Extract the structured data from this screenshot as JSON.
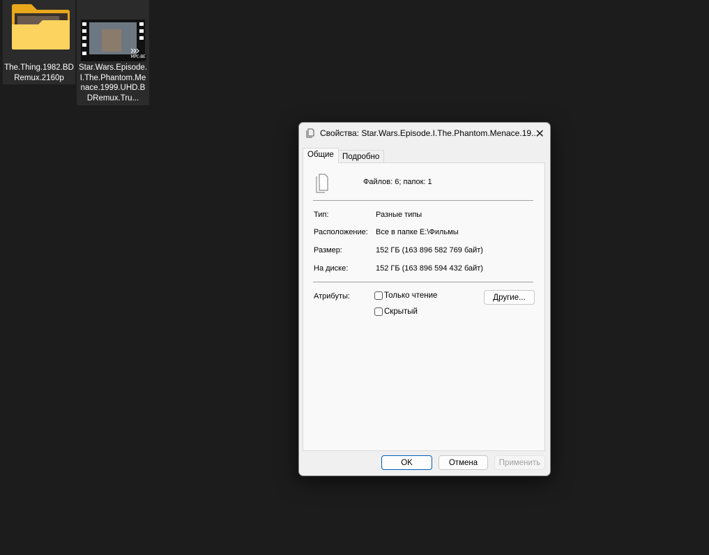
{
  "desktop": {
    "items": [
      {
        "label": "The.Thing.1982.BDRemux.2160p",
        "icon": "folder-icon"
      },
      {
        "label": "Star.Wars.Episode.I.The.Phantom.Menace.1999.UHD.BDRemux.Tru...",
        "icon": "video-file-icon",
        "badge": "MPC-BE"
      }
    ]
  },
  "dialog": {
    "title": "Свойства: Star.Wars.Episode.I.The.Phantom.Menace.19...",
    "tabs": [
      "Общие",
      "Подробно"
    ],
    "summary": "Файлов: 6; папок: 1",
    "fields": [
      {
        "label": "Тип:",
        "value": "Разные типы"
      },
      {
        "label": "Расположение:",
        "value": "Все в папке E:\\Фильмы"
      },
      {
        "label": "Размер:",
        "value": "152 ГБ (163 896 582 769 байт)"
      },
      {
        "label": "На диске:",
        "value": "152 ГБ (163 896 594 432 байт)"
      }
    ],
    "attributes_label": "Атрибуты:",
    "readonly": "Только чтение",
    "hidden": "Скрытый",
    "other": "Другие...",
    "ok": "OK",
    "cancel": "Отмена",
    "apply": "Применить"
  },
  "colors": {
    "folder": "#f6c443",
    "accent": "#005fb8"
  }
}
